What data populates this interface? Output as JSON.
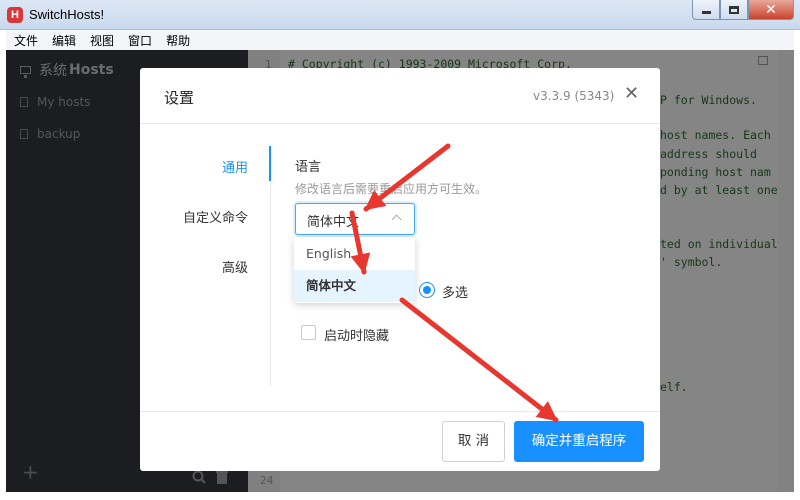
{
  "window": {
    "title": "SwitchHosts!",
    "app_icon_letter": "H",
    "controls": {
      "close": "✕"
    }
  },
  "menu": [
    "文件",
    "编辑",
    "视图",
    "窗口",
    "帮助"
  ],
  "sidebar": {
    "header_prefix": "系统",
    "header_bold": "Hosts",
    "items": [
      "My hosts",
      "backup"
    ],
    "add": "+"
  },
  "editor": {
    "line_numbers": [
      "1",
      "24"
    ],
    "lines": [
      "# Copyright (c) 1993-2009 Microsoft Corp.",
      "P for Windows.",
      "host names. Each",
      "address should",
      "ponding host nam",
      "d by at least one",
      "ted on individual",
      "' symbol.",
      "elf."
    ]
  },
  "dialog": {
    "title": "设置",
    "version": "v3.3.9 (5343)",
    "close": "✕",
    "nav": [
      "通用",
      "自定义命令",
      "高级"
    ],
    "language": {
      "label": "语言",
      "hint": "修改语言后需要重启应用方可生效。",
      "selected": "简体中文",
      "options": [
        "English",
        "简体中文"
      ]
    },
    "radio_label": "多选",
    "checkbox_label": "启动时隐藏",
    "buttons": {
      "cancel": "取 消",
      "ok": "确定并重启程序"
    }
  },
  "colors": {
    "accent": "#1890ff",
    "annotation_arrow": "#e8372f",
    "sidebar_bg": "#33363d",
    "code_comment": "#2b6a2d"
  }
}
